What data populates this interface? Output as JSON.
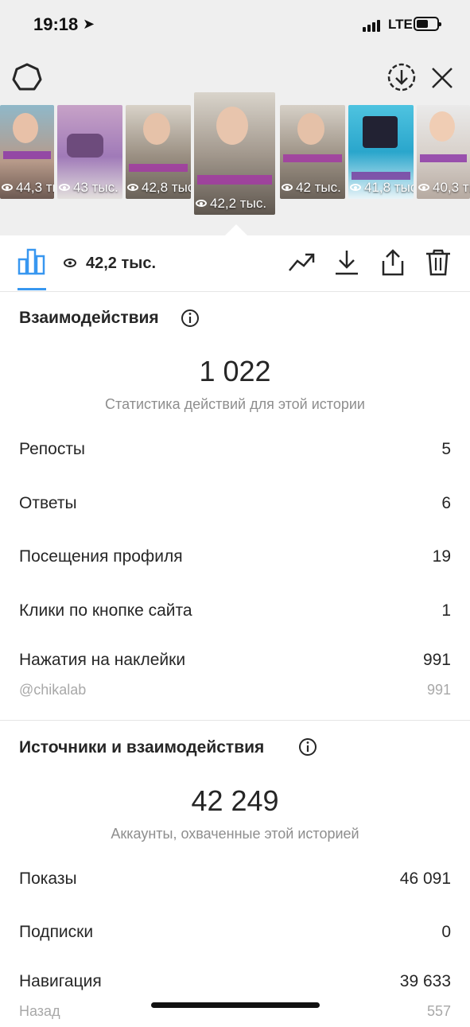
{
  "status_bar": {
    "time": "19:18",
    "location_glyph": "➤",
    "network": "LTE"
  },
  "story_thumbnails": [
    {
      "views": "44,3 тыс."
    },
    {
      "views": "43 тыс."
    },
    {
      "views": "42,8 тыс."
    },
    {
      "views": "42,2 тыс.",
      "selected": true
    },
    {
      "views": "42 тыс."
    },
    {
      "views": "41,8 тыс."
    },
    {
      "views": "40,3 тыс."
    }
  ],
  "toolbar": {
    "views_count": "42,2 тыс."
  },
  "interactions": {
    "title": "Взаимодействия",
    "total": "1 022",
    "caption": "Статистика действий для этой истории",
    "rows": [
      {
        "label": "Репосты",
        "value": "5"
      },
      {
        "label": "Ответы",
        "value": "6"
      },
      {
        "label": "Посещения профиля",
        "value": "19"
      },
      {
        "label": "Клики по кнопке сайта",
        "value": "1"
      },
      {
        "label": "Нажатия на наклейки",
        "value": "991"
      }
    ],
    "sub_row": {
      "label": "@chikalab",
      "value": "991"
    }
  },
  "discovery": {
    "title": "Источники и взаимодействия",
    "total": "42 249",
    "caption": "Аккаунты, охваченные этой историей",
    "rows": [
      {
        "label": "Показы",
        "value": "46 091"
      },
      {
        "label": "Подписки",
        "value": "0"
      },
      {
        "label": "Навигация",
        "value": "39 633"
      }
    ],
    "sub_row": {
      "label": "Назад",
      "value": "557"
    }
  },
  "colors": {
    "accent": "#3897f0",
    "topbar_bg": "#efefef",
    "muted": "#8e8e8e"
  }
}
